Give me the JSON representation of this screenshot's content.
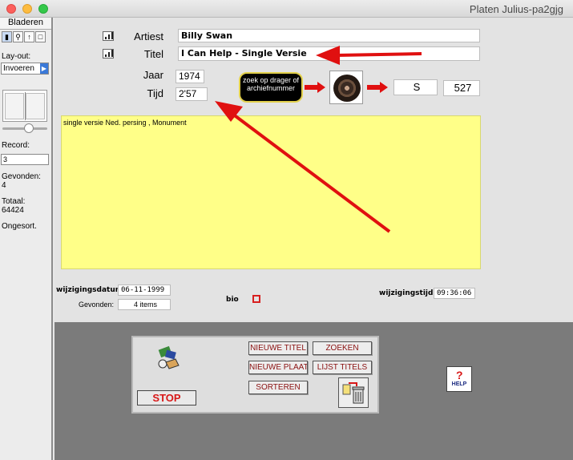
{
  "window": {
    "title": "Platen Julius-pa2gjg"
  },
  "sidebar": {
    "header": "Bladeren",
    "layout_label": "Lay-out:",
    "layout_value": "Invoeren",
    "record_label": "Record:",
    "record_value": "3",
    "found_label": "Gevonden:",
    "found_value": "4",
    "total_label": "Totaal:",
    "total_value": "64424",
    "sort_label": "Ongesort."
  },
  "form": {
    "artist_label": "Artiest",
    "artist_value": "Billy Swan",
    "title_label": "Titel",
    "title_value": "I Can Help - Single Versie",
    "year_label": "Jaar",
    "year_value": "1974",
    "time_label": "Tijd",
    "time_value": "2'57",
    "search_badge": "zoek op drager of archiefnummer",
    "carrier_value": "S",
    "archive_value": "527",
    "notes": "single versie   Ned. persing , Monument",
    "modified_date_label": "wijzigingsdatum",
    "modified_date_value": "06-11-1999",
    "found_label": "Gevonden:",
    "found_value": "4 items",
    "bio_label": "bio",
    "modified_time_label": "wijzigingstijd",
    "modified_time_value": "09:36:06"
  },
  "toolbar": {
    "new_title": "NIEUWE TITEL",
    "search": "ZOEKEN",
    "new_record": "NIEUWE PLAAT",
    "list_titles": "LIJST TITELS",
    "sort": "SORTEREN",
    "stop": "STOP",
    "help": "HELP"
  },
  "colors": {
    "annotation_arrow": "#e01010",
    "notes_background": "#ffff88",
    "bottom_panel": "#7b7b7b"
  }
}
